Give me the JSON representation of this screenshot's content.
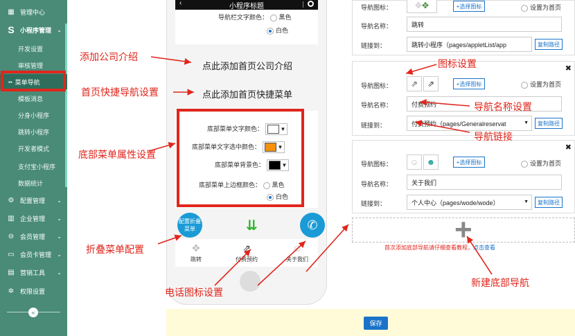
{
  "sidebar": {
    "top_items": [
      {
        "label": "管理中心",
        "icon": "dashboard-icon"
      },
      {
        "label": "小程序管理",
        "icon": "s-logo-icon"
      }
    ],
    "sub_items": [
      "开发设置",
      "审核管理",
      "菜单导航",
      "模板消息",
      "分身小程序",
      "跳转小程序",
      "开发者模式",
      "支付宝小程序",
      "数据统计"
    ],
    "active_sub": "菜单导航",
    "bottom_items": [
      {
        "label": "配置管理",
        "icon": "gear-icon"
      },
      {
        "label": "企业管理",
        "icon": "building-icon"
      },
      {
        "label": "会员管理",
        "icon": "lock-icon"
      },
      {
        "label": "会员卡管理",
        "icon": "card-icon"
      },
      {
        "label": "营销工具",
        "icon": "tools-icon"
      },
      {
        "label": "权限设置",
        "icon": "settings-icon"
      }
    ],
    "collapse_glyph": "«"
  },
  "annotations": {
    "company_intro": "添加公司介绍",
    "quick_nav": "首页快捷导航设置",
    "bottom_menu": "底部菜单属性设置",
    "fold_menu": "折叠菜单配置",
    "phone_icon": "电话图标设置",
    "icon_setting": "图标设置",
    "nav_name": "导航名称设置",
    "nav_link": "导航链接",
    "new_bottom_nav": "新建底部导航"
  },
  "phone": {
    "title": "小程序标题",
    "nav_text_color_label": "导航栏文字颜色：",
    "black": "黑色",
    "white": "白色",
    "add_company_intro": "点此添加首页公司介绍",
    "add_quick_menu": "点此添加首页快捷菜单",
    "bottom_menu": {
      "text_color_label": "底部菜单文字颜色：",
      "text_selected_color_label": "底部菜单文字选中颜色：",
      "bg_color_label": "底部菜单背景色：",
      "border_color_label": "底部菜单上边框颜色：",
      "text_color": "#ffffff",
      "selected_color": "#f5900a",
      "bg_color": "#000000",
      "border_option_black": "黑色",
      "border_option_white": "白色",
      "border_selected": "白色"
    },
    "fold_button": "配置折叠菜单",
    "tabs": [
      "跳转",
      "付费预约",
      "关于我们"
    ]
  },
  "nav_cards": [
    {
      "icon_label": "导航图标：",
      "pick_label": "+选择图标",
      "set_home": "设置为首页",
      "name_label": "导航名称：",
      "name": "跳转",
      "link_label": "链接到：",
      "link": "跳转小程序（pages/appletList/app",
      "copy": "复制路径"
    },
    {
      "icon_label": "导航图标：",
      "pick_label": "+选择图标",
      "set_home": "设置为首页",
      "name_label": "导航名称：",
      "name": "付费预约",
      "link_label": "链接到：",
      "link": "付费预约（pages/Generalreservat",
      "copy": "复制路径"
    },
    {
      "icon_label": "导航图标：",
      "pick_label": "+选择图标",
      "set_home": "设置为首页",
      "name_label": "导航名称：",
      "name": "关于我们",
      "link_label": "链接到：",
      "link": "个人中心（pages/wode/wode）",
      "copy": "复制路径"
    }
  ],
  "hint": {
    "text": "首次添加底部导航请仔细查看教程，",
    "link": "点击查看"
  },
  "save": "保存",
  "colors": {
    "sidebar": "#4a8b78",
    "accent": "#1a73c9",
    "annotation": "#e0261c"
  }
}
